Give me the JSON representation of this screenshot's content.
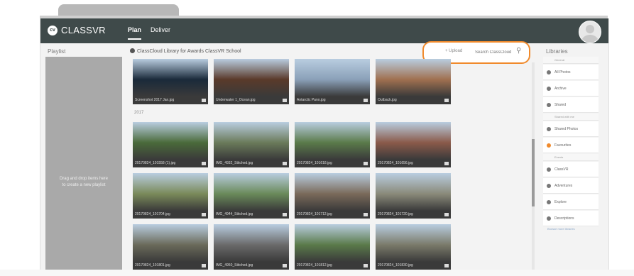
{
  "app": {
    "logo_text": "CLASSVR",
    "logo_mark": "cv"
  },
  "nav": {
    "items": [
      {
        "label": "Plan"
      },
      {
        "label": "Deliver"
      }
    ]
  },
  "playlist": {
    "title": "Playlist",
    "drop_hint": "Drag and drop items here to create a new playlist"
  },
  "library": {
    "title": "ClassCloud Library for Awards ClassVR School",
    "section_label": "2017"
  },
  "search": {
    "upload_label": "+ Upload",
    "placeholder": "Search ClassCloud"
  },
  "resources": {
    "title": "Libraries",
    "items": [
      {
        "label": "General",
        "sub": true
      },
      {
        "label": "All Photos",
        "icon": "photo-icon"
      },
      {
        "label": "Archive",
        "icon": "archive-icon"
      },
      {
        "label": "Shared",
        "icon": "shared-icon"
      },
      {
        "label": "Shared with me",
        "sub": true
      },
      {
        "label": "Shared Photos",
        "icon": "image-icon"
      },
      {
        "label": "Favourites",
        "icon": "star-icon",
        "active": true
      },
      {
        "label": "Events",
        "sub": true
      },
      {
        "label": "ClassVR",
        "icon": "cloud-icon"
      },
      {
        "label": "Adventures",
        "icon": "adventure-icon"
      },
      {
        "label": "Explore",
        "icon": "explore-icon"
      },
      {
        "label": "Descriptions",
        "icon": "description-icon"
      }
    ],
    "link": "Browse more libraries"
  },
  "tiles": [
    {
      "caption": "Screenshot 2017 Jan.jpg",
      "bg": "#1a2a3a"
    },
    {
      "caption": "Underwater 1_Ocean.jpg",
      "bg": "#5a3a2a"
    },
    {
      "caption": "Antarctic Pano.jpg",
      "bg": "#8aa0b8"
    },
    {
      "caption": "Outback.jpg",
      "bg": "#a07050"
    },
    {
      "caption": "20170824_101558 (1).jpg",
      "bg": "#4a6a3a"
    },
    {
      "caption": "IMG_4932_Stitched.jpg",
      "bg": "#6a7a5a"
    },
    {
      "caption": "20170824_101618.jpg",
      "bg": "#5a7a4a"
    },
    {
      "caption": "20170824_101656.jpg",
      "bg": "#8a5a4a"
    },
    {
      "caption": "20170824_101704.jpg",
      "bg": "#7a8a5a"
    },
    {
      "caption": "IMG_4944_Stitched.jpg",
      "bg": "#6a8a5a"
    },
    {
      "caption": "20170824_101712.jpg",
      "bg": "#7a6a5a"
    },
    {
      "caption": "20170824_101720.jpg",
      "bg": "#8a8a7a"
    },
    {
      "caption": "20170824_101801.jpg",
      "bg": "#6a6a5a"
    },
    {
      "caption": "IMG_4950_Stitched.jpg",
      "bg": "#6a6a6a"
    },
    {
      "caption": "20170824_101812.jpg",
      "bg": "#5a7a4a"
    },
    {
      "caption": "20170824_101830.jpg",
      "bg": "#7a7a6a"
    }
  ]
}
